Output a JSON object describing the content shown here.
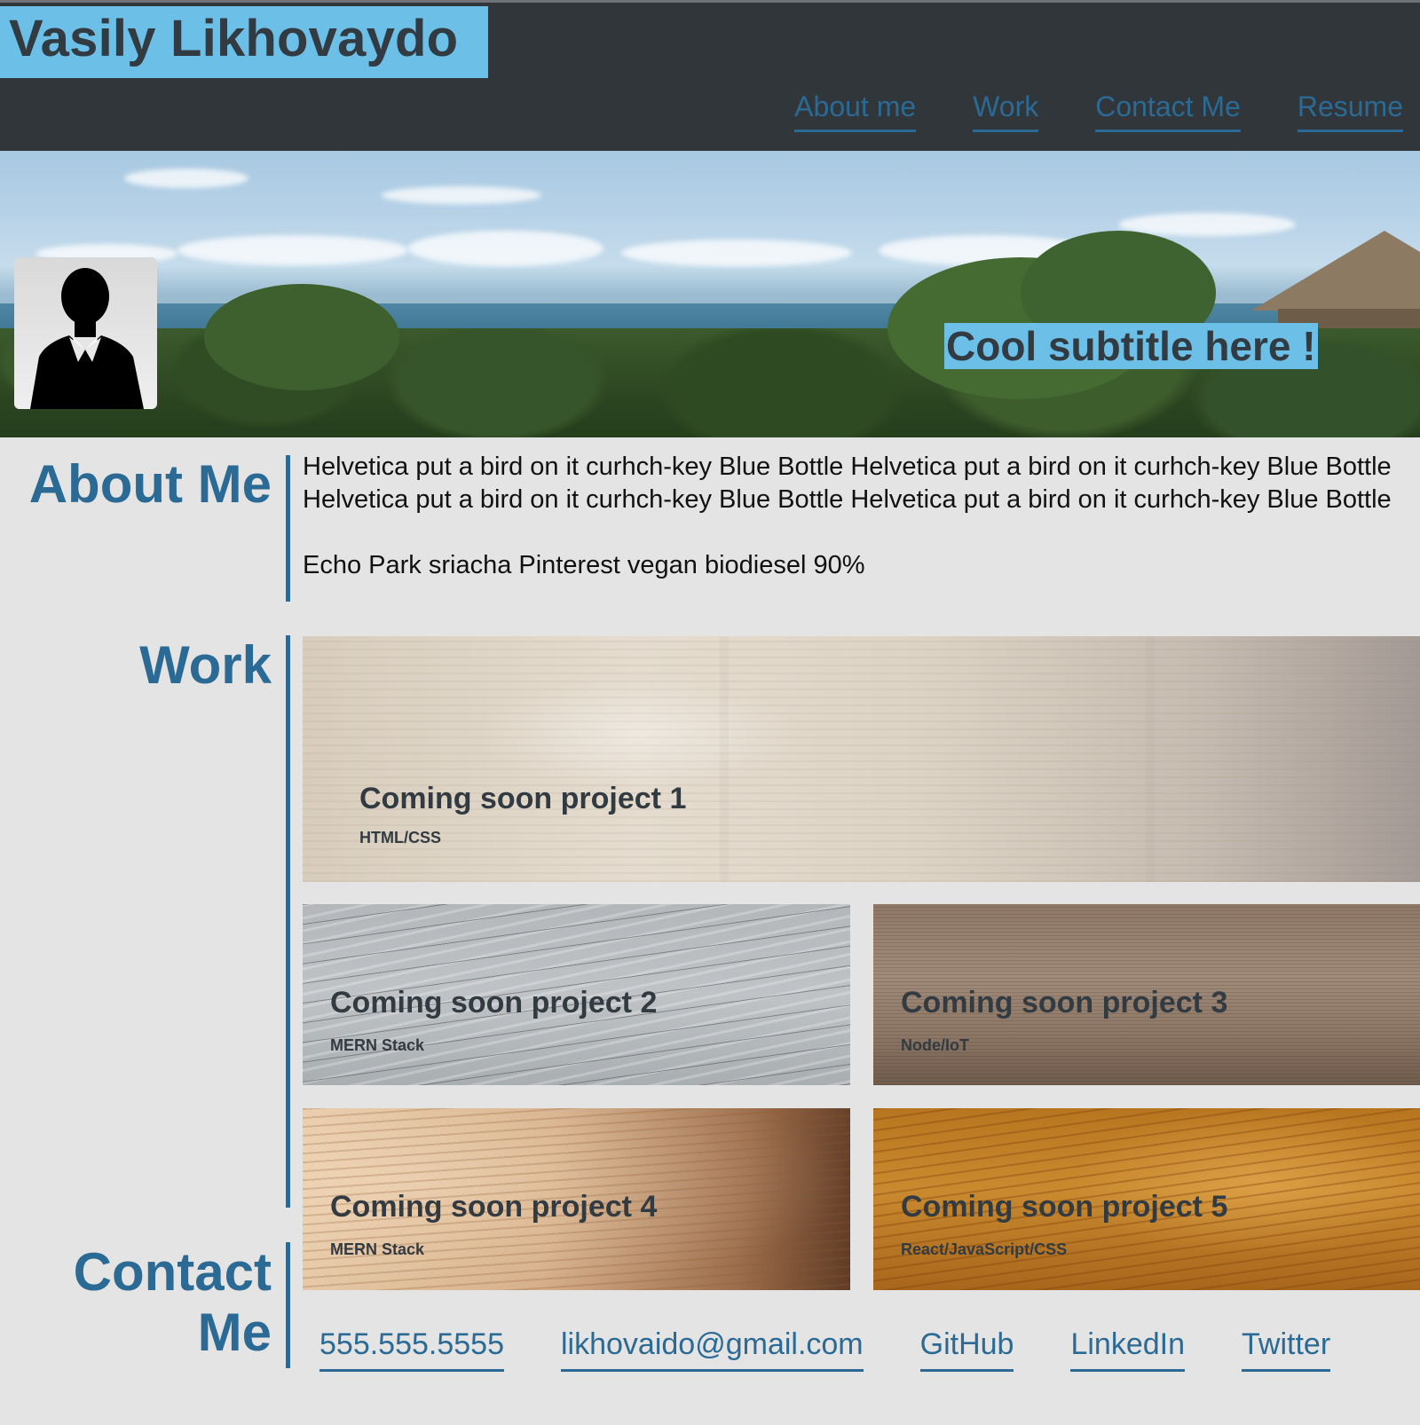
{
  "header": {
    "title": "Vasily Likhovaydo",
    "nav": [
      "About me",
      "Work",
      "Contact Me",
      "Resume"
    ]
  },
  "hero": {
    "subtitle": "Cool subtitle here !"
  },
  "about": {
    "heading": "About Me",
    "paragraphs": [
      "Helvetica put a bird on it curhch-key Blue Bottle Helvetica put a bird on it curhch-key Blue Bottle Helvetica put a bird on it curhch-key Blue Bottle Helvetica put a bird on it curhch-key Blue Bottle",
      "Echo Park sriacha Pinterest vegan biodiesel 90%"
    ]
  },
  "work": {
    "heading": "Work",
    "projects": [
      {
        "title": "Coming soon project 1",
        "tag": "HTML/CSS"
      },
      {
        "title": "Coming soon project 2",
        "tag": "MERN Stack"
      },
      {
        "title": "Coming soon project 3",
        "tag": "Node/IoT"
      },
      {
        "title": "Coming soon project 4",
        "tag": "MERN Stack"
      },
      {
        "title": "Coming soon project 5",
        "tag": "React/JavaScript/CSS"
      }
    ]
  },
  "contact": {
    "heading_line1": "Contact",
    "heading_line2": "Me",
    "links": [
      "555.555.5555",
      "likhovaido@gmail.com",
      "GitHub",
      "LinkedIn",
      "Twitter"
    ]
  },
  "colors": {
    "header_bg": "#31363b",
    "accent_bg": "#6cbfe7",
    "link": "#2b6a94",
    "page_bg": "#e4e4e4"
  }
}
